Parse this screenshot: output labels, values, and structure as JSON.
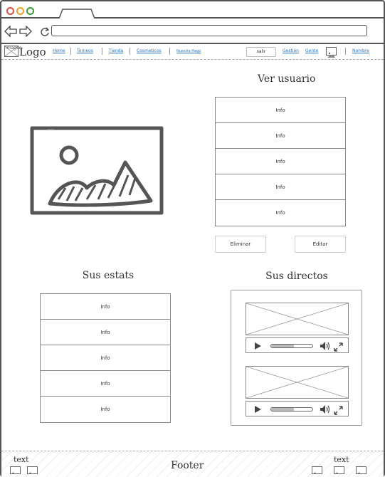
{
  "browser": {
    "window_controls": [
      "close",
      "minimize",
      "maximize"
    ],
    "url": ""
  },
  "navbar": {
    "logo_image_label": "Imagen",
    "logo_text": "Logo",
    "links": [
      "Home",
      "Torneos",
      "Tienda",
      "Cosmeticos",
      "Nuestra Hago"
    ],
    "salir_label": "salir",
    "gestion_label": "Gestión",
    "gente_label": "Gente",
    "nombre_label": "Nombre"
  },
  "ver_usuario": {
    "title": "Ver usuario",
    "rows": [
      "Info",
      "Info",
      "Info",
      "Info",
      "Info"
    ],
    "eliminar_label": "Eliminar",
    "editar_label": "Editar"
  },
  "sus_estats": {
    "title": "Sus estats",
    "rows": [
      "Info",
      "Info",
      "Info",
      "Info",
      "Info"
    ]
  },
  "sus_directos": {
    "title": "Sus directos",
    "videos": [
      {
        "progress": 0.55
      },
      {
        "progress": 0.55
      }
    ]
  },
  "footer": {
    "left_text": "text",
    "title": "Footer",
    "right_text": "text"
  },
  "colors": {
    "link": "#2a6fb8",
    "border": "#555555",
    "close": "#d9503f",
    "minimize": "#e0a228",
    "maximize": "#3a9a3a"
  }
}
